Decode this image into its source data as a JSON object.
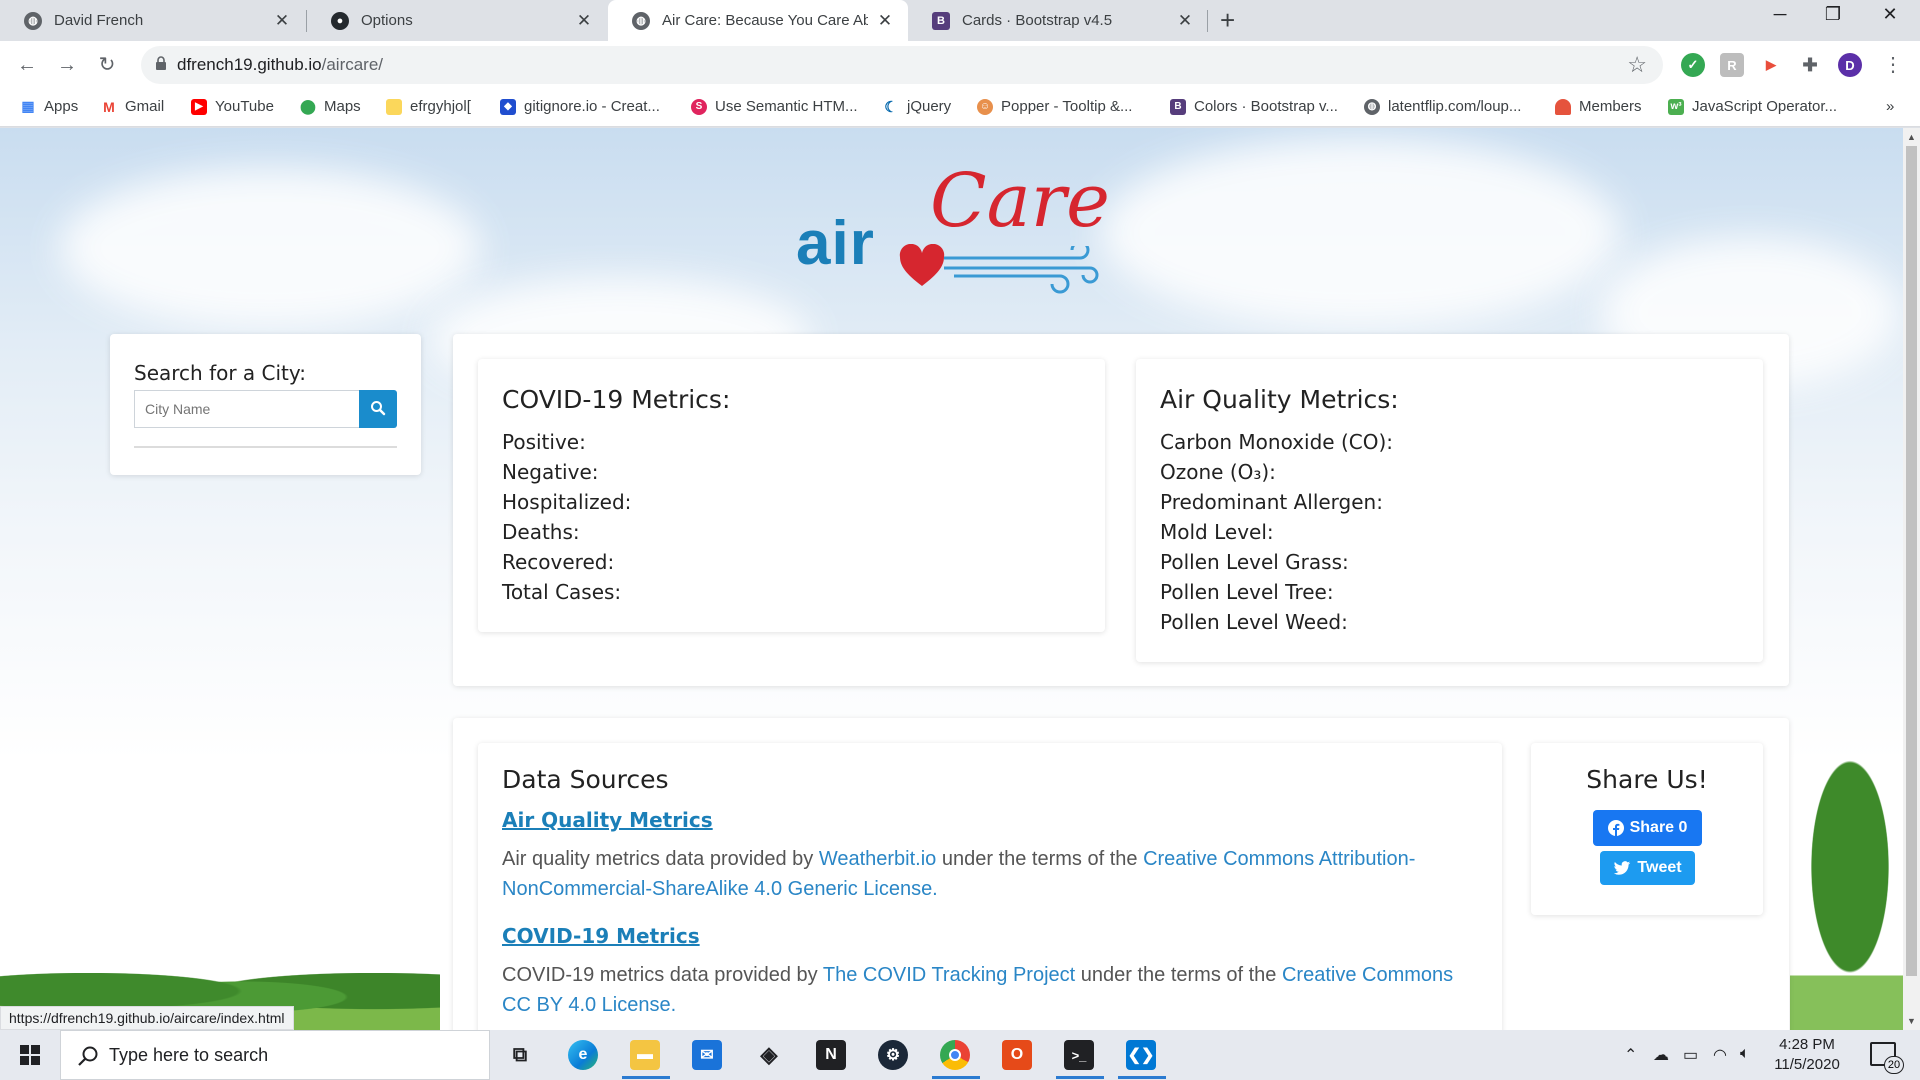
{
  "browser": {
    "tabs": [
      {
        "title": "David French",
        "icon": "github-icon",
        "active": false
      },
      {
        "title": "Options",
        "icon": "github-icon",
        "active": false
      },
      {
        "title": "Air Care: Because You Care Abou",
        "icon": "globe-icon",
        "active": true
      },
      {
        "title": "Cards · Bootstrap v4.5",
        "icon": "bootstrap-icon",
        "active": false
      }
    ],
    "new_tab": "+",
    "url_host": "dfrench19.github.io",
    "url_path": "/aircare/",
    "profile_initial": "D",
    "bookmarks": [
      {
        "label": "Apps",
        "icon": "apps-grid-icon",
        "color": "#4285f4"
      },
      {
        "label": "Gmail",
        "icon": "gmail-icon",
        "color": "#ea4335"
      },
      {
        "label": "YouTube",
        "icon": "youtube-icon",
        "color": "#ff0000"
      },
      {
        "label": "Maps",
        "icon": "maps-pin-icon",
        "color": "#34a853"
      },
      {
        "label": "efrgyhjol[",
        "icon": "folder-icon",
        "color": "#fbd75b"
      },
      {
        "label": "gitignore.io - Creat...",
        "icon": "gitignore-icon",
        "color": "#204ecf"
      },
      {
        "label": "Use Semantic HTM...",
        "icon": "semantic-icon",
        "color": "#e0245e"
      },
      {
        "label": "jQuery",
        "icon": "jquery-icon",
        "color": "#0769ad"
      },
      {
        "label": "Popper - Tooltip &...",
        "icon": "popper-icon",
        "color": "#e8904c"
      },
      {
        "label": "Colors · Bootstrap v...",
        "icon": "bootstrap-icon",
        "color": "#563d7c"
      },
      {
        "label": "latentflip.com/loup...",
        "icon": "globe-icon",
        "color": "#5f6368"
      },
      {
        "label": "Members",
        "icon": "members-icon",
        "color": "#e5533d"
      },
      {
        "label": "JavaScript Operator...",
        "icon": "w3schools-icon",
        "color": "#4caf50"
      }
    ],
    "more_bookmarks": "»",
    "status_url": "https://dfrench19.github.io/aircare/index.html"
  },
  "page": {
    "logo": {
      "air": "air",
      "care": "Care"
    },
    "search": {
      "title": "Search for a City:",
      "placeholder": "City Name"
    },
    "covid": {
      "title": "COVID-19 Metrics:",
      "items": [
        "Positive:",
        "Negative:",
        "Hospitalized:",
        "Deaths:",
        "Recovered:",
        "Total Cases:"
      ]
    },
    "air_quality": {
      "title": "Air Quality Metrics:",
      "items": [
        "Carbon Monoxide (CO):",
        "Ozone (O₃):",
        "Predominant Allergen:",
        "Mold Level:",
        "Pollen Level Grass:",
        "Pollen Level Tree:",
        "Pollen Level Weed:"
      ]
    },
    "data_sources": {
      "title": "Data Sources",
      "aq_link": "Air Quality Metrics",
      "aq_text_1": "Air quality metrics data provided by ",
      "aq_provider": "Weatherbit.io",
      "aq_text_2": " under the terms of the ",
      "aq_license": "Creative Commons Attribution-NonCommercial-ShareAlike 4.0 Generic License.",
      "covid_link": "COVID-19 Metrics",
      "covid_text_1": "COVID-19 metrics data provided by ",
      "covid_provider": "The COVID Tracking Project",
      "covid_text_2": " under the terms of the ",
      "covid_license": "Creative Commons CC BY 4.0 License."
    },
    "share": {
      "title": "Share Us!",
      "facebook": "Share 0",
      "twitter": "Tweet"
    }
  },
  "taskbar": {
    "search_placeholder": "Type here to search",
    "time": "4:28 PM",
    "date": "11/5/2020",
    "notifications": "20"
  },
  "colors": {
    "brand_blue": "#1b7fb8",
    "brand_red": "#d6262f",
    "search_button": "#1a8ccc",
    "facebook": "#1877f2",
    "twitter": "#1d9bf0"
  }
}
